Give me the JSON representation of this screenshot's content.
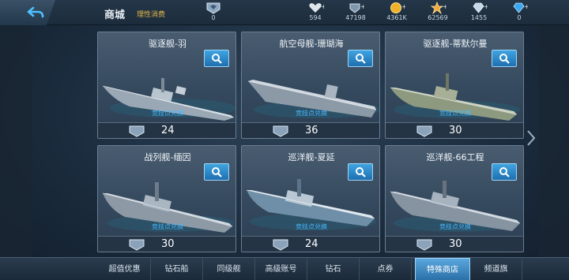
{
  "header": {
    "title": "商城",
    "subtitle": "理性消费"
  },
  "resources": [
    {
      "icon": "badge-icon",
      "value": "0"
    },
    {
      "icon": "heart-icon",
      "value": "594"
    },
    {
      "icon": "medal-icon",
      "value": "47198"
    },
    {
      "icon": "gold-coin-icon",
      "value": "4361K"
    },
    {
      "icon": "star-icon",
      "value": "62569"
    },
    {
      "icon": "diamond-icon",
      "value": "1455"
    },
    {
      "icon": "gem-icon",
      "value": "0"
    }
  ],
  "cards": [
    {
      "name": "驱逐舰-羽",
      "redeem": "竞技点兑换",
      "price": "24"
    },
    {
      "name": "航空母舰-珊瑚海",
      "redeem": "竞技点兑换",
      "price": "36"
    },
    {
      "name": "驱逐舰-蒂默尔曼",
      "redeem": "竞技点兑换",
      "price": "30"
    },
    {
      "name": "战列舰-缅因",
      "redeem": "竞技点兑换",
      "price": "30"
    },
    {
      "name": "巡洋舰-夏延",
      "redeem": "竞技点兑换",
      "price": "24"
    },
    {
      "name": "巡洋舰-66工程",
      "redeem": "竞技点兑换",
      "price": "30"
    }
  ],
  "nav": [
    {
      "label": "超值优惠"
    },
    {
      "label": "钻石船"
    },
    {
      "label": "同级舰"
    },
    {
      "label": "高级账号"
    },
    {
      "label": "钻石"
    },
    {
      "label": "点券"
    },
    {
      "label": "特殊商店"
    },
    {
      "label": "频道旗"
    }
  ],
  "active_tab": "特殊商店",
  "colors": {
    "accent": "#2b70a8",
    "highlight_text": "#e0b84a",
    "redeem_text": "#46b8ff"
  }
}
